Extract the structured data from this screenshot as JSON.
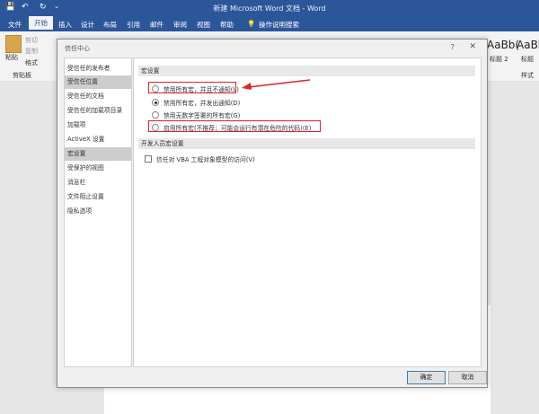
{
  "window": {
    "title": "新建 Microsoft Word 文档 - Word"
  },
  "ribbon": {
    "tabs": [
      "文件",
      "开始",
      "插入",
      "设计",
      "布局",
      "引用",
      "邮件",
      "审阅",
      "视图",
      "帮助"
    ],
    "search": "操作说明搜索",
    "paste_label": "粘贴",
    "cut_label": "剪切",
    "copy_label": "复制",
    "format_painter_label": "格式",
    "clipboard_group": "剪贴板",
    "styles_group": "样式",
    "style_sample_1": "AaBb(",
    "style_sample_1_name": "标题 2",
    "style_sample_2": "AaBb",
    "style_sample_2_name": "标题"
  },
  "dialog": {
    "title": "信任中心",
    "help": "?",
    "close": "✕",
    "nav": [
      "受信任的发布者",
      "受信任位置",
      "受信任的文档",
      "受信任的加载项目录",
      "加载项",
      "ActiveX 设置",
      "宏设置",
      "受保护的视图",
      "消息栏",
      "文件阻止设置",
      "隐私选项"
    ],
    "macro_section": "宏设置",
    "macro_options": [
      "禁用所有宏，并且不通知(L)",
      "禁用所有宏，并发出通知(D)",
      "禁用无数字签署的所有宏(G)",
      "启用所有宏(不推荐；可能会运行有潜在危险的代码)(E)"
    ],
    "dev_section": "开发人员宏设置",
    "vba_option": "信任对 VBA 工程对象模型的访问(V)",
    "ok": "确定",
    "cancel": "取消"
  },
  "colors": {
    "word_blue": "#2b579a",
    "highlight_red": "#e02323",
    "selected_nav": "#cdcdcd"
  }
}
